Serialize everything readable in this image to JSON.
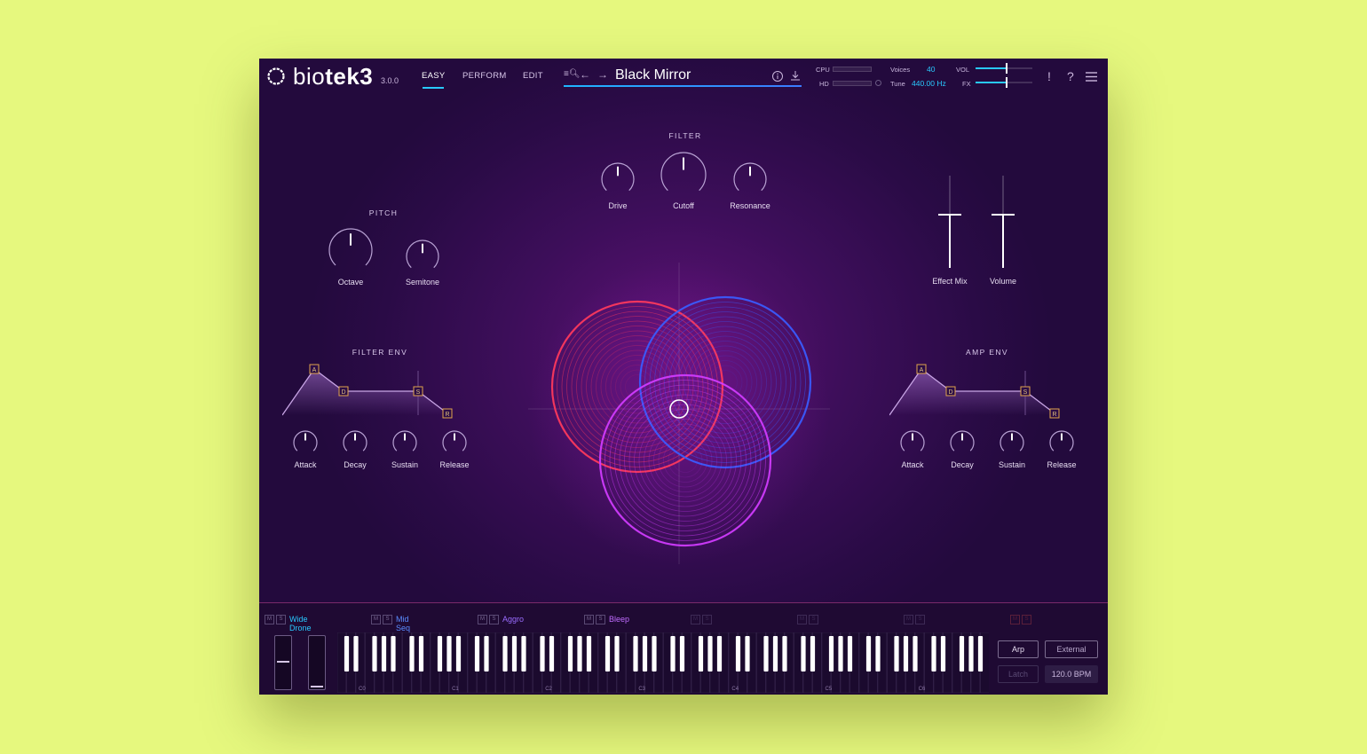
{
  "header": {
    "brand_bio": "bio",
    "brand_tek": "tek3",
    "version": "3.0.0",
    "tabs": [
      {
        "label": "EASY",
        "active": true
      },
      {
        "label": "PERFORM",
        "active": false
      },
      {
        "label": "EDIT",
        "active": false
      }
    ],
    "preset_name": "Black Mirror",
    "cpu_label": "CPU",
    "hd_label": "HD",
    "voices_label": "Voices",
    "voices_value": "40",
    "tune_label": "Tune",
    "tune_value": "440.00 Hz",
    "vol_label": "VOL",
    "fx_label": "FX",
    "vol_level": 0.55,
    "fx_level": 0.55,
    "alert_glyph": "!",
    "help_glyph": "?"
  },
  "filter": {
    "title": "FILTER",
    "knobs": [
      {
        "label": "Drive",
        "value": 0.5
      },
      {
        "label": "Cutoff",
        "value": 0.5
      },
      {
        "label": "Resonance",
        "value": 0.5
      }
    ]
  },
  "pitch": {
    "title": "PITCH",
    "knobs": [
      {
        "label": "Octave",
        "value": 0.5
      },
      {
        "label": "Semitone",
        "value": 0.5
      }
    ]
  },
  "mix": {
    "sliders": [
      {
        "label": "Effect Mix",
        "value": 0.58
      },
      {
        "label": "Volume",
        "value": 0.58
      }
    ]
  },
  "filter_env": {
    "title": "FILTER ENV",
    "points": [
      "A",
      "D",
      "S",
      "R"
    ],
    "knobs": [
      {
        "label": "Attack",
        "value": 0.5
      },
      {
        "label": "Decay",
        "value": 0.5
      },
      {
        "label": "Sustain",
        "value": 0.5
      },
      {
        "label": "Release",
        "value": 0.5
      }
    ]
  },
  "amp_env": {
    "title": "AMP ENV",
    "points": [
      "A",
      "D",
      "S",
      "R"
    ],
    "knobs": [
      {
        "label": "Attack",
        "value": 0.5
      },
      {
        "label": "Decay",
        "value": 0.5
      },
      {
        "label": "Sustain",
        "value": 0.5
      },
      {
        "label": "Release",
        "value": 0.5
      }
    ]
  },
  "layers": [
    {
      "name": "Wide Drone",
      "color": "#29c9ff"
    },
    {
      "name": "Mid Seq",
      "color": "#5a8cff"
    },
    {
      "name": "Aggro",
      "color": "#9a6cff"
    },
    {
      "name": "Bleep",
      "color": "#c06cff"
    },
    {
      "name": "",
      "color": "#3d2a55"
    },
    {
      "name": "",
      "color": "#3d2a55"
    },
    {
      "name": "",
      "color": "#3d2a55"
    },
    {
      "name": "",
      "color": "#5a1f3a"
    }
  ],
  "layer_m": "M",
  "layer_s": "S",
  "keyboard": {
    "octave_labels": [
      "C0",
      "C1",
      "C2",
      "C3",
      "C4",
      "C5",
      "C6"
    ]
  },
  "controls": {
    "arp": "Arp",
    "external": "External",
    "latch": "Latch",
    "bpm": "120.0 BPM"
  },
  "colors": {
    "accent": "#29c9ff",
    "circle_red": "#ff3a5c",
    "circle_blue": "#3a5cff",
    "circle_magenta": "#d23cff"
  }
}
